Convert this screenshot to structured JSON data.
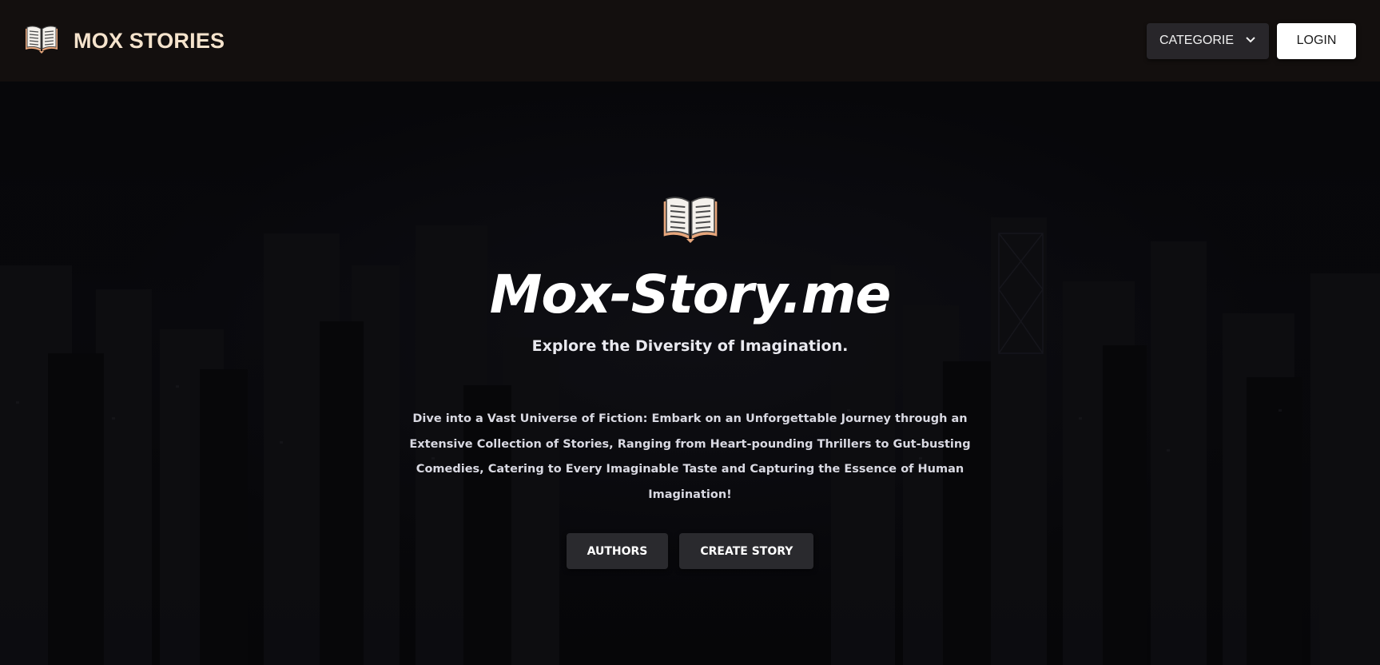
{
  "header": {
    "brand_icon": "open-book-icon",
    "brand_title": "MOX STORIES",
    "category_button": "CATEGORIE",
    "category_icon": "chevron-down-icon",
    "login_button": "LOGIN"
  },
  "hero": {
    "icon": "open-book-icon",
    "title": "Mox-Story.me",
    "subtitle": "Explore the Diversity of Imagination.",
    "description": "Dive into a Vast Universe of Fiction: Embark on an Unforgettable Journey through an Extensive Collection of Stories, Ranging from Heart-pounding Thrillers to Gut-busting Comedies, Catering to Every Imaginable Taste and Capturing the Essence of Human Imagination!",
    "actions": [
      {
        "label": "AUTHORS"
      },
      {
        "label": "CREATE STORY"
      }
    ]
  },
  "colors": {
    "header_bg": "#130f0e",
    "brand_text": "#f5e3cc",
    "book_cover": "#e8a77c",
    "button_dark": "#2a2a2e",
    "button_light": "#ffffff"
  }
}
